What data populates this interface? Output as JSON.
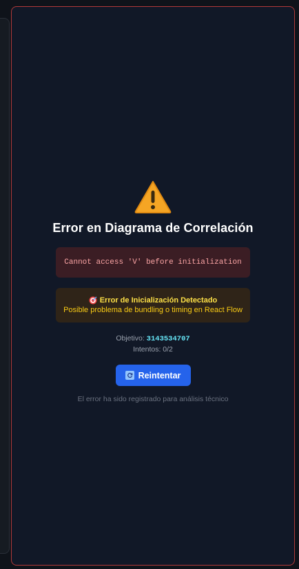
{
  "error": {
    "title": "Error en Diagrama de Correlación",
    "message": "Cannot access 'V' before initialization",
    "init_title": "Error de Inicialización Detectado",
    "init_description": "Posible problema de bundling o timing en React Flow",
    "target_label": "Objetivo:",
    "target_value": "3143534707",
    "attempts_label": "Intentos:",
    "attempts_value": "0/2",
    "retry_label": "Reintentar",
    "footer": "El error ha sido registrado para análisis técnico"
  },
  "colors": {
    "card_border": "#b23a3a",
    "error_text": "#fca5a5",
    "warning_text": "#fde047",
    "target_value": "#67e8f9",
    "retry_button": "#2563eb"
  },
  "icons": {
    "main": "warning-icon",
    "init": "target-icon",
    "retry": "refresh-icon"
  }
}
